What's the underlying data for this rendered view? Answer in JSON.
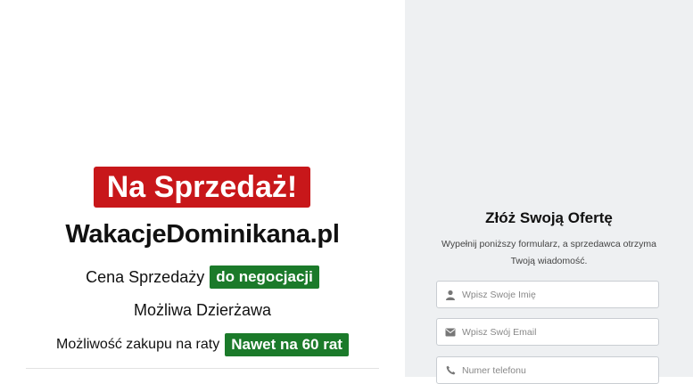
{
  "listing": {
    "sale_label": "Na Sprzedaż!",
    "domain_name": "WakacjeDominikana.pl",
    "price_label": "Cena Sprzedaży",
    "price_value": "do negocjacji",
    "lease_label": "Możliwa Dzierżawa",
    "installments_label": "Możliwość zakupu na raty",
    "installments_value": "Nawet na 60 rat"
  },
  "offer_form": {
    "title": "Złóż Swoją Ofertę",
    "subtitle": "Wypełnij poniższy formularz, a sprzedawca otrzyma Twoją wiadomość.",
    "name_placeholder": "Wpisz Swoje Imię",
    "email_placeholder": "Wpisz Swój Email",
    "phone_placeholder": "Numer telefonu"
  },
  "icons": {
    "name_field": "user-icon",
    "email_field": "envelope-icon",
    "phone_field": "phone-icon"
  },
  "colors": {
    "sale_badge": "#c8171a",
    "tag_green": "#1b7a2a",
    "right_panel": "#eef0f2"
  }
}
